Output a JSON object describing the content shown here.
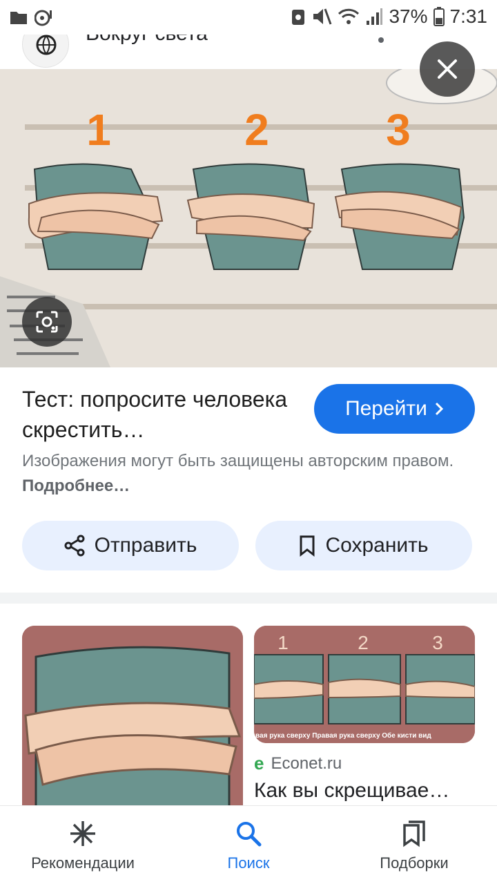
{
  "status_bar": {
    "battery": "37%",
    "time": "7:31",
    "icons": [
      "folder-icon",
      "media-icon",
      "android-icon",
      "mute-icon",
      "wifi-icon",
      "signal-icon",
      "battery-icon"
    ]
  },
  "source": {
    "name": "Вокруг света"
  },
  "hero": {
    "numbers": [
      "1",
      "2",
      "3"
    ]
  },
  "result": {
    "title": "Тест: попросите человека скрестить…",
    "visit_label": "Перейти",
    "copyright_text": "Изображения могут быть защищены авторским правом.",
    "copyright_link": "Подробнее…"
  },
  "actions": {
    "share_label": "Отправить",
    "save_label": "Сохранить"
  },
  "related": {
    "right_numbers": [
      "1",
      "2",
      "3"
    ],
    "right_caption": "вая рука сверху  Правая рука сверху  Обе кисти вид",
    "source": "Econet.ru",
    "title": "Как вы скрещивае…"
  },
  "bottom_nav": {
    "items": [
      {
        "label": "Рекомендации",
        "icon": "asterisk-icon",
        "active": false
      },
      {
        "label": "Поиск",
        "icon": "search-icon",
        "active": true
      },
      {
        "label": "Подборки",
        "icon": "collections-icon",
        "active": false
      }
    ]
  },
  "colors": {
    "accent": "#1a73e8",
    "pill_bg": "#e8f0fe",
    "orange_numbers": "#f07d1e",
    "shirt": "#6b948f",
    "card_bg": "#a86b67"
  }
}
